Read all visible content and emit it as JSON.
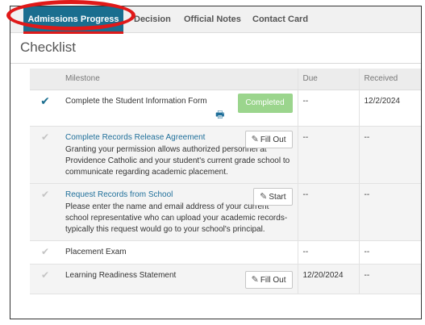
{
  "tabs": [
    {
      "label": "Admissions Progress",
      "active": true
    },
    {
      "label": "Decision",
      "active": false
    },
    {
      "label": "Official Notes",
      "active": false
    },
    {
      "label": "Contact Card",
      "active": false
    }
  ],
  "section_title": "Checklist",
  "table": {
    "headers": {
      "milestone": "Milestone",
      "due": "Due",
      "received": "Received"
    },
    "rows": [
      {
        "title": "Complete the Student Information Form",
        "description": "",
        "status": "Completed",
        "action": "",
        "due": "--",
        "received": "12/2/2024",
        "done": true,
        "print_icon": "printer-icon"
      },
      {
        "title": "Complete Records Release Agreement",
        "description": "Granting your permission allows authorized personnel at Providence Catholic and your student's current grade school to communicate regarding academic placement.",
        "status": "",
        "action": "Fill Out",
        "due": "--",
        "received": "--",
        "done": false
      },
      {
        "title": "Request Records from School",
        "description": "Please enter the name and email address of your current school representative who can upload your academic records- typically this request would go to your school's principal.",
        "status": "",
        "action": "Start",
        "due": "--",
        "received": "--",
        "done": false
      },
      {
        "title": "Placement Exam",
        "description": "",
        "status": "",
        "action": "",
        "due": "--",
        "received": "--",
        "done": false
      },
      {
        "title": "Learning Readiness Statement",
        "description": "",
        "status": "",
        "action": "Fill Out",
        "due": "12/20/2024",
        "received": "--",
        "done": false
      }
    ]
  },
  "colors": {
    "tab_active": "#1a6e8f",
    "completed_badge": "#9bd58d",
    "link": "#1f6f9a",
    "highlight": "#e01919"
  },
  "icons": {
    "done": "check-icon",
    "pending": "check-outline-icon",
    "edit": "pencil-square-icon",
    "print": "printer-icon"
  }
}
